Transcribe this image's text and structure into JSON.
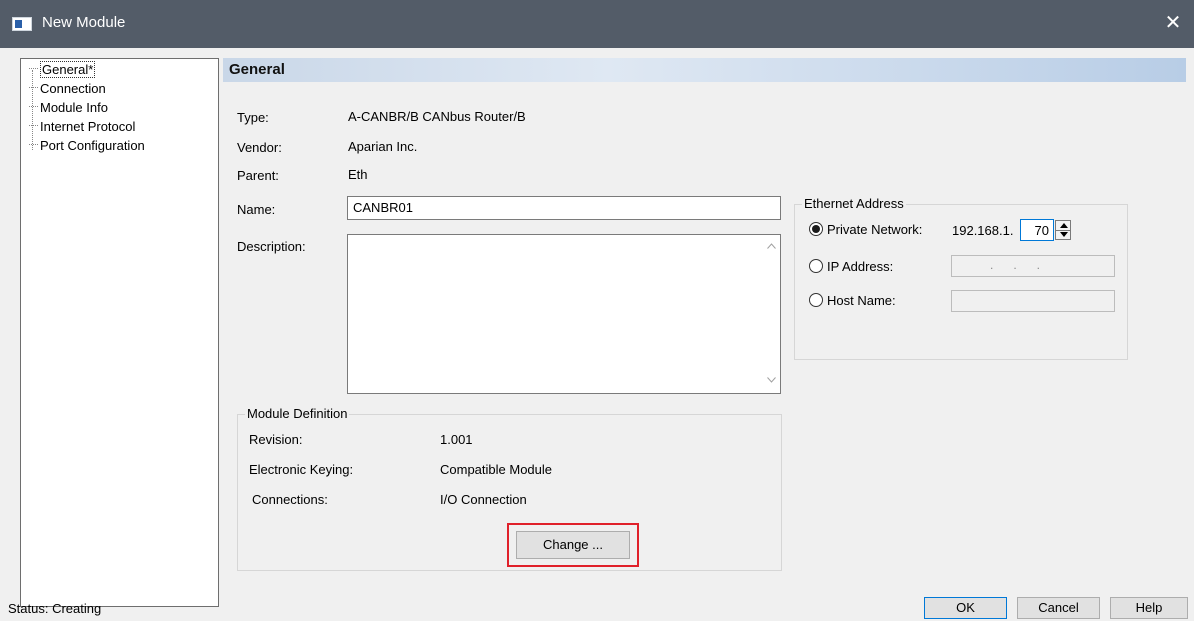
{
  "window": {
    "title": "New Module",
    "close_glyph": "✕"
  },
  "tree": {
    "items": [
      {
        "label": "General*",
        "selected": true
      },
      {
        "label": "Connection"
      },
      {
        "label": "Module Info"
      },
      {
        "label": "Internet Protocol"
      },
      {
        "label": "Port Configuration"
      }
    ]
  },
  "section_title": "General",
  "general": {
    "type_label": "Type:",
    "type_value": "A-CANBR/B CANbus Router/B",
    "vendor_label": "Vendor:",
    "vendor_value": "Aparian Inc.",
    "parent_label": "Parent:",
    "parent_value": "Eth",
    "name_label": "Name:",
    "name_value": "CANBR01",
    "description_label": "Description:",
    "description_value": ""
  },
  "ethernet": {
    "group_label": "Ethernet Address",
    "private_label": "Private Network:",
    "private_prefix": "192.168.1.",
    "private_octet": "70",
    "ip_label": "IP Address:",
    "ip_value": ".      .      .",
    "host_label": "Host Name:",
    "host_value": "",
    "selected": "private"
  },
  "module_definition": {
    "group_label": "Module Definition",
    "revision_label": "Revision:",
    "revision_value": "1.001",
    "keying_label": "Electronic Keying:",
    "keying_value": "Compatible Module",
    "connections_label": "Connections:",
    "connections_value": "I/O Connection",
    "change_label": "Change ..."
  },
  "status": {
    "text": "Status:  Creating"
  },
  "buttons": {
    "ok": "OK",
    "cancel": "Cancel",
    "help": "Help"
  },
  "colors": {
    "titlebar": "#535c68",
    "highlight": "#e0202a",
    "header_gradient": "#c9d7e8"
  }
}
